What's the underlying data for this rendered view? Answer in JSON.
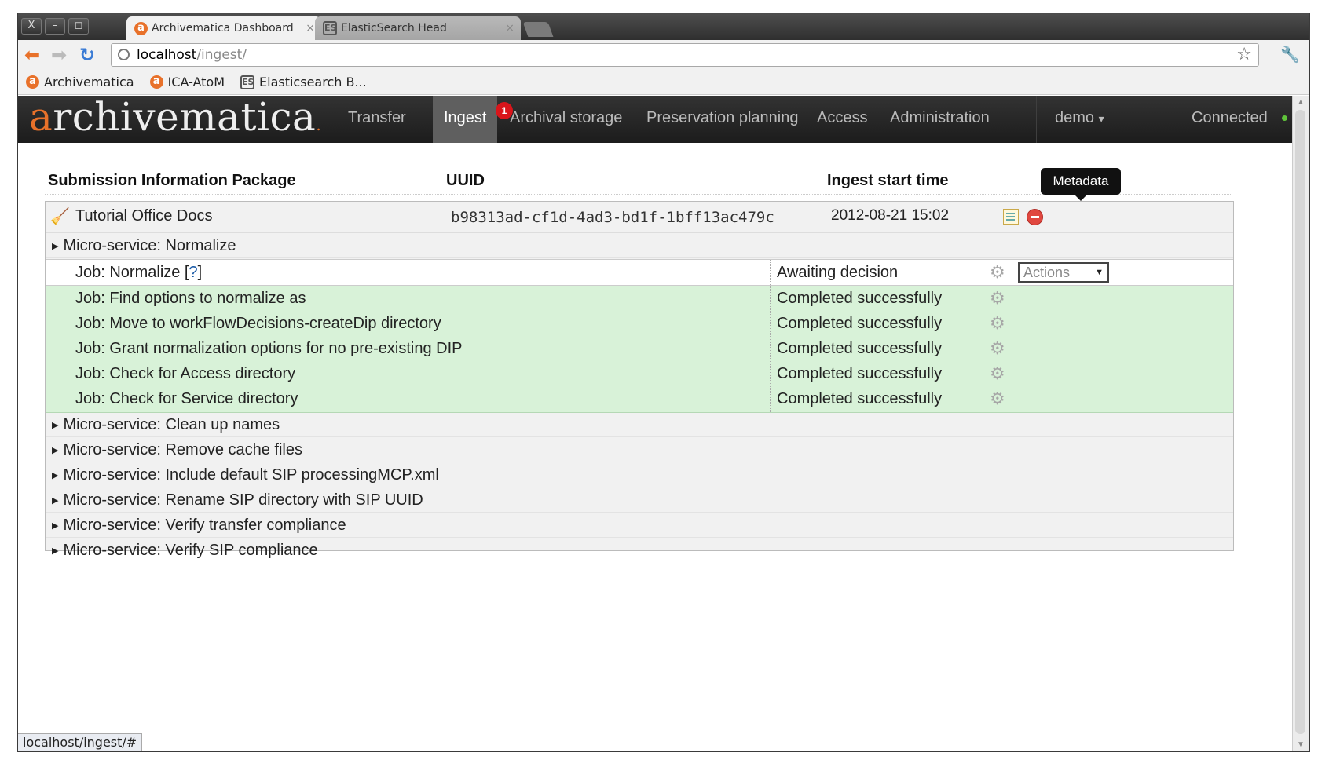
{
  "browser": {
    "tabs": [
      {
        "label": "Archivematica Dashboard",
        "close": "×"
      },
      {
        "label": "ElasticSearch Head",
        "close": "×"
      }
    ],
    "window_buttons": [
      "X",
      "–",
      "◻"
    ],
    "url_host": "localhost",
    "url_path": "/ingest/",
    "bookmarks": [
      "Archivematica",
      "ICA-AtoM",
      "Elasticsearch B..."
    ],
    "status_url": "localhost/ingest/#"
  },
  "app": {
    "logo_a": "a",
    "logo_rest": "rchivematica",
    "logo_dot": ".",
    "nav": [
      "Transfer",
      "Ingest",
      "Archival storage",
      "Preservation planning",
      "Access",
      "Administration"
    ],
    "ingest_badge": "1",
    "user": "demo",
    "user_caret": "▾",
    "connection": "Connected"
  },
  "table": {
    "headers": {
      "sip": "Submission Information Package",
      "uuid": "UUID",
      "start": "Ingest start time"
    },
    "tooltip": "Metadata",
    "sip": {
      "name": "Tutorial Office Docs",
      "uuid": "b98313ad-cf1d-4ad3-bd1f-1bff13ac479c",
      "start": "2012-08-21 15:02"
    },
    "open_microservice": "Micro-service: Normalize",
    "jobs": [
      {
        "name": "Job: Normalize [",
        "help": "?",
        "close": "]",
        "status": "Awaiting decision",
        "action": "Actions"
      },
      {
        "name": "Job: Find options to normalize as",
        "status": "Completed successfully"
      },
      {
        "name": "Job: Move to workFlowDecisions-createDip directory",
        "status": "Completed successfully"
      },
      {
        "name": "Job: Grant normalization options for no pre-existing DIP",
        "status": "Completed successfully"
      },
      {
        "name": "Job: Check for Access directory",
        "status": "Completed successfully"
      },
      {
        "name": "Job: Check for Service directory",
        "status": "Completed successfully"
      }
    ],
    "microservices": [
      "Micro-service: Clean up names",
      "Micro-service: Remove cache files",
      "Micro-service: Include default SIP processingMCP.xml",
      "Micro-service: Rename SIP directory with SIP UUID",
      "Micro-service: Verify transfer compliance",
      "Micro-service: Verify SIP compliance"
    ],
    "expand_glyph": "▶",
    "select_caret": "▼"
  },
  "icons": {
    "gear": "gear-icon",
    "metadata": "metadata-edit-icon",
    "delete": "remove-icon",
    "sip": "broom-icon"
  },
  "colors": {
    "brand_orange": "#e8712a",
    "navbar": "#1c1c1c",
    "success_row": "#d8f2d8",
    "badge_red": "#d9151b",
    "connected_green": "#5fc33a"
  }
}
